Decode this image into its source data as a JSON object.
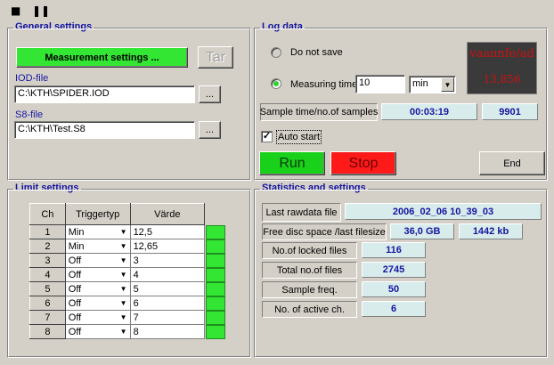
{
  "window": {
    "stop_glyph": "■",
    "pause_glyph": "❚❚"
  },
  "general": {
    "title": "General settings",
    "measurement_button": "Measurement settings ...",
    "tar_button": "Tar",
    "iod_label": "IOD-file",
    "iod_value": "C:\\KTH\\SPIDER.IOD",
    "s8_label": "S8-file",
    "s8_value": "C:\\KTH\\Test.S8",
    "browse_label": "..."
  },
  "log": {
    "title": "Log data",
    "do_not_save": "Do not save",
    "measuring_time": "Measuring time",
    "time_value": "10",
    "unit_value": "min",
    "display_line1": "vaaunfe/ad",
    "display_line2": "13,856",
    "sample_label": "Sample time/no.of samples",
    "sample_time": "00:03:19",
    "sample_count": "9901",
    "auto_start": "Auto start",
    "auto_start_checked": true,
    "run": "Run",
    "stop": "Stop",
    "end": "End",
    "accent_active": "#2bd62b"
  },
  "limits": {
    "title": "Limit settings",
    "headers": [
      "Ch",
      "Triggertyp",
      "Värde"
    ],
    "rows": [
      {
        "ch": "1",
        "trigger": "Min",
        "value": "12,5"
      },
      {
        "ch": "2",
        "trigger": "Min",
        "value": "12,65"
      },
      {
        "ch": "3",
        "trigger": "Off",
        "value": "3"
      },
      {
        "ch": "4",
        "trigger": "Off",
        "value": "4"
      },
      {
        "ch": "5",
        "trigger": "Off",
        "value": "5"
      },
      {
        "ch": "6",
        "trigger": "Off",
        "value": "6"
      },
      {
        "ch": "7",
        "trigger": "Off",
        "value": "7"
      },
      {
        "ch": "8",
        "trigger": "Off",
        "value": "8"
      }
    ],
    "indicator_color": "#33e633"
  },
  "stats": {
    "title": "Statistics and settings",
    "last_raw_label": "Last rawdata file",
    "last_raw_value": "2006_02_06 10_39_03",
    "free_disc_label": "Free disc space /last filesize",
    "free_disc_value": "36,0 GB",
    "last_size_value": "1442 kb",
    "locked_label": "No.of locked files",
    "locked_value": "116",
    "total_label": "Total no.of files",
    "total_value": "2745",
    "freq_label": "Sample freq.",
    "freq_value": "50",
    "active_label": "No. of active ch.",
    "active_value": "6"
  }
}
